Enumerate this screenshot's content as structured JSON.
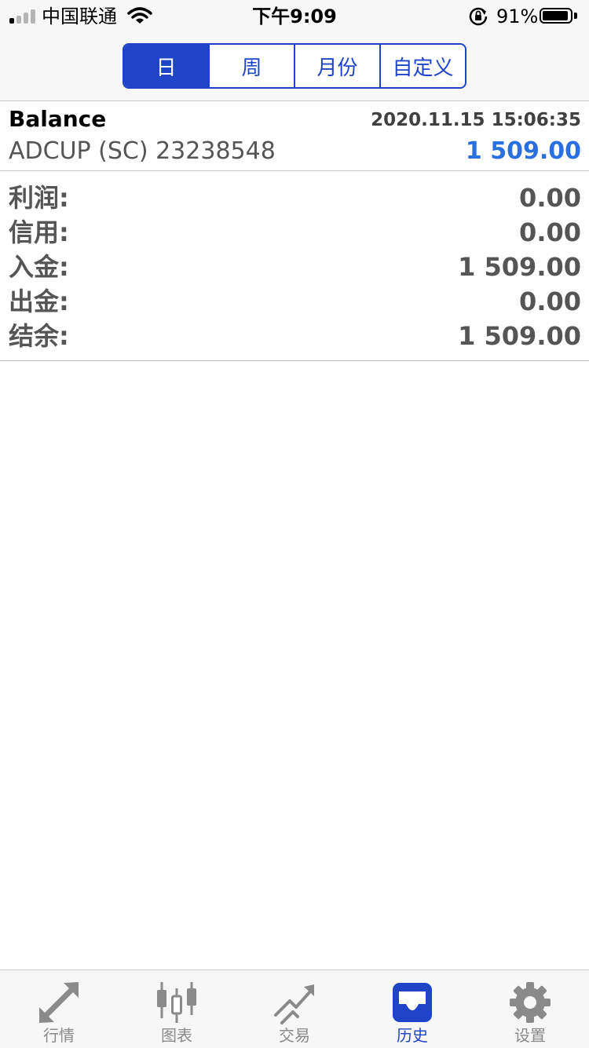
{
  "status_bar": {
    "carrier": "中国联通",
    "time": "下午9:09",
    "battery": "91%"
  },
  "period_tabs": {
    "items": [
      {
        "label": "日",
        "active": true
      },
      {
        "label": "周",
        "active": false
      },
      {
        "label": "月份",
        "active": false
      },
      {
        "label": "自定义",
        "active": false
      }
    ]
  },
  "record": {
    "type": "Balance",
    "datetime": "2020.11.15 15:06:35",
    "account": "ADCUP (SC) 23238548",
    "amount": "1 509.00"
  },
  "summary": {
    "rows": [
      {
        "label": "利润:",
        "value": "0.00"
      },
      {
        "label": "信用:",
        "value": "0.00"
      },
      {
        "label": "入金:",
        "value": "1 509.00"
      },
      {
        "label": "出金:",
        "value": "0.00"
      },
      {
        "label": "结余:",
        "value": "1 509.00"
      }
    ]
  },
  "tab_bar": {
    "items": [
      {
        "label": "行情",
        "icon": "quotes-arrows-icon",
        "active": false
      },
      {
        "label": "图表",
        "icon": "candlestick-chart-icon",
        "active": false
      },
      {
        "label": "交易",
        "icon": "trade-trend-icon",
        "active": false
      },
      {
        "label": "历史",
        "icon": "history-inbox-icon",
        "active": true
      },
      {
        "label": "设置",
        "icon": "gear-icon",
        "active": false
      }
    ]
  },
  "colors": {
    "accent": "#1f44c8",
    "amount": "#2a6fe0",
    "inactive": "#8a8a8a"
  }
}
